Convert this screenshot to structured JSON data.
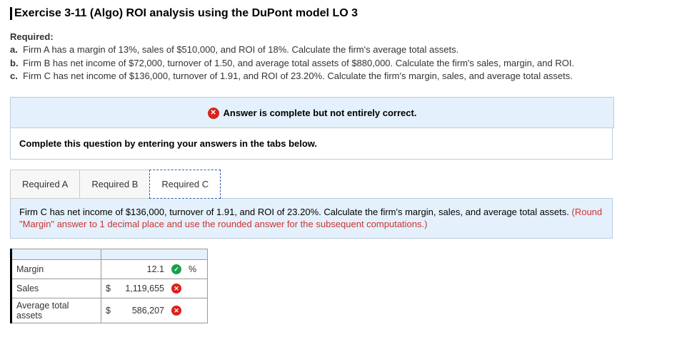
{
  "title": "Exercise 3-11 (Algo) ROI analysis using the DuPont model LO 3",
  "required_label": "Required:",
  "requirements": [
    {
      "letter": "a.",
      "text": "Firm A has a margin of 13%, sales of $510,000, and ROI of 18%. Calculate the firm's average total assets."
    },
    {
      "letter": "b.",
      "text": "Firm B has net income of $72,000, turnover of 1.50, and average total assets of $880,000. Calculate the firm's sales, margin, and ROI."
    },
    {
      "letter": "c.",
      "text": "Firm C has net income of $136,000, turnover of 1.91, and ROI of 23.20%. Calculate the firm's margin, sales, and average total assets."
    }
  ],
  "status_message": "Answer is complete but not entirely correct.",
  "instruction": "Complete this question by entering your answers in the tabs below.",
  "tabs": [
    {
      "label": "Required A"
    },
    {
      "label": "Required B"
    },
    {
      "label": "Required C"
    }
  ],
  "active_tab": 2,
  "tab_c": {
    "prompt_main": "Firm C has net income of $136,000, turnover of 1.91, and ROI of 23.20%. Calculate the firm's margin, sales, and average total assets. ",
    "prompt_note": "(Round \"Margin\" answer to 1 decimal place and use the rounded answer for the subsequent computations.)"
  },
  "answers": {
    "margin": {
      "label": "Margin",
      "value": "12.1",
      "unit": "%",
      "correct": true
    },
    "sales": {
      "label": "Sales",
      "prefix": "$",
      "value": "1,119,655",
      "correct": false
    },
    "ata": {
      "label": "Average total assets",
      "prefix": "$",
      "value": "586,207",
      "correct": false
    }
  }
}
